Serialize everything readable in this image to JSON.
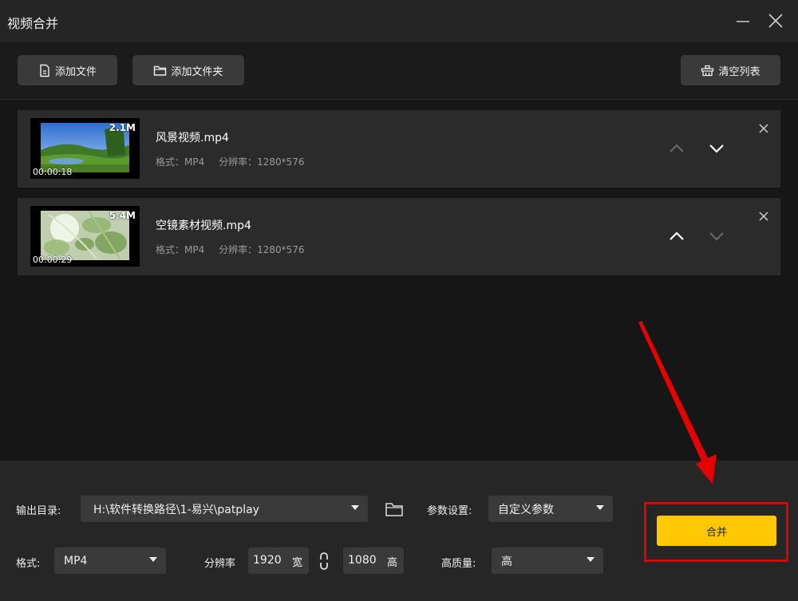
{
  "window": {
    "title": "视频合并"
  },
  "toolbar": {
    "add_file_label": "添加文件",
    "add_folder_label": "添加文件夹",
    "clear_list_label": "清空列表"
  },
  "files": [
    {
      "name": "风景视频.mp4",
      "format": "格式：MP4",
      "resolution": "分辨率：1280*576",
      "size": "2.1M",
      "duration": "00:00:18"
    },
    {
      "name": "空镜素材视频.mp4",
      "format": "格式：MP4",
      "resolution": "分辨率：1280*576",
      "size": "5.4M",
      "duration": "00:00:29"
    }
  ],
  "settings": {
    "output_dir_label": "输出目录:",
    "output_dir_value": "H:\\软件转换路径\\1-易兴\\patplay",
    "params_label": "参数设置:",
    "params_value": "自定义参数",
    "format_label": "格式:",
    "format_value": "MP4",
    "resolution_label": "分辨率",
    "width_value": "1920",
    "width_unit": "宽",
    "height_value": "1080",
    "height_unit": "高",
    "quality_label": "高质量:",
    "quality_value": "高"
  },
  "merge_button_label": "合并",
  "colors": {
    "accent": "#ffc805",
    "highlight": "#e00000",
    "background": "#161616",
    "panel": "#2b2b2b"
  }
}
